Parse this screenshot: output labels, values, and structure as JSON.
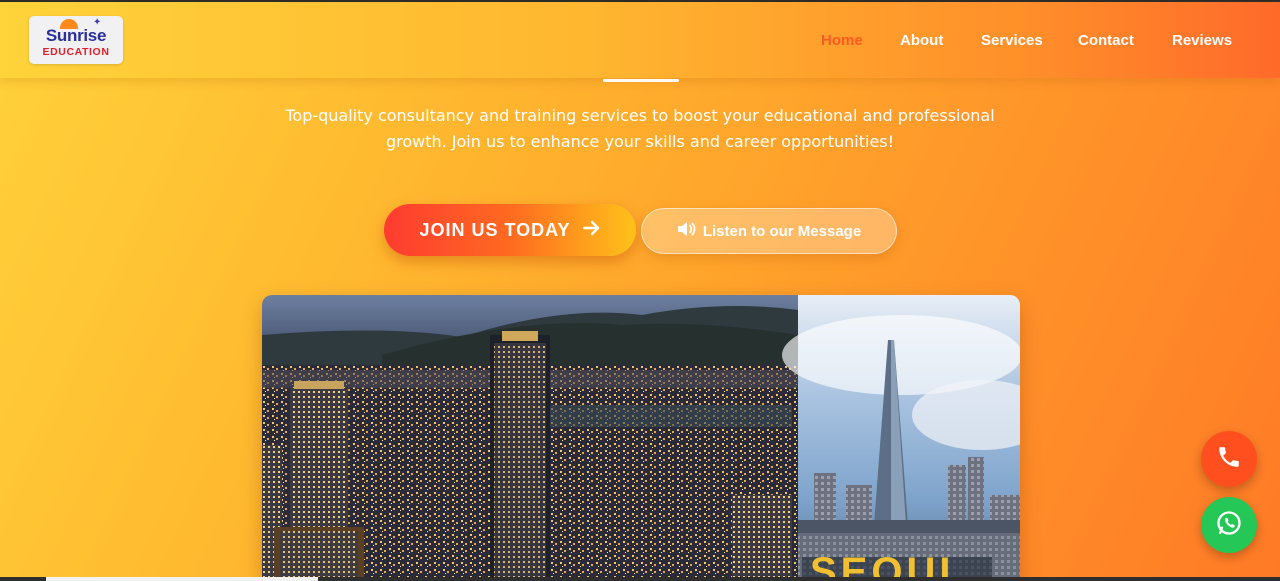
{
  "logo": {
    "line1": "Sunrise",
    "line2": "EDUCATION"
  },
  "nav": {
    "items": [
      {
        "label": "Home",
        "active": true
      },
      {
        "label": "About"
      },
      {
        "label": "Services"
      },
      {
        "label": "Contact"
      },
      {
        "label": "Reviews"
      }
    ]
  },
  "hero": {
    "tagline_line1": "Top-quality consultancy and training services to boost your educational and professional",
    "tagline_line2": "growth. Join us to enhance your skills and career opportunities!",
    "join_label": "JOIN US TODAY",
    "join_icon": "arrow-right-icon",
    "listen_label": "Listen to our Message",
    "listen_icon": "speaker-icon"
  },
  "fabs": {
    "call_icon": "phone-icon",
    "whatsapp_icon": "whatsapp-icon"
  },
  "colors": {
    "accent": "#ff5a1f",
    "brand_blue": "#2c2f9a",
    "whatsapp": "#25c756"
  }
}
